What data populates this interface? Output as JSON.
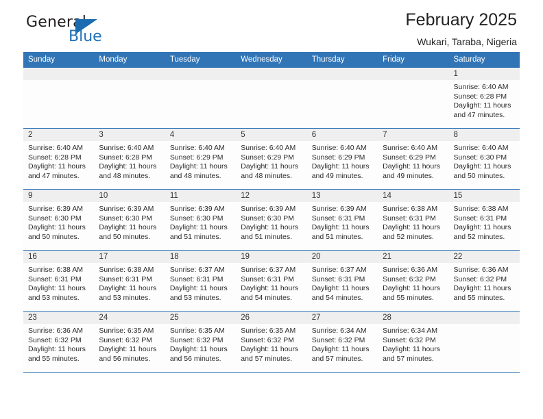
{
  "brand": {
    "name_top": "General",
    "name_bottom": "Blue",
    "accent_color": "#2272b8"
  },
  "header": {
    "title": "February 2025",
    "subtitle": "Wukari, Taraba, Nigeria"
  },
  "calendar": {
    "header_bg": "#3175b6",
    "weekdays": [
      "Sunday",
      "Monday",
      "Tuesday",
      "Wednesday",
      "Thursday",
      "Friday",
      "Saturday"
    ],
    "labels": {
      "sunrise": "Sunrise:",
      "sunset": "Sunset:",
      "daylight": "Daylight:"
    },
    "weeks": [
      [
        {
          "day": ""
        },
        {
          "day": ""
        },
        {
          "day": ""
        },
        {
          "day": ""
        },
        {
          "day": ""
        },
        {
          "day": ""
        },
        {
          "day": "1",
          "sunrise": "Sunrise: 6:40 AM",
          "sunset": "Sunset: 6:28 PM",
          "daylight": "Daylight: 11 hours and 47 minutes."
        }
      ],
      [
        {
          "day": "2",
          "sunrise": "Sunrise: 6:40 AM",
          "sunset": "Sunset: 6:28 PM",
          "daylight": "Daylight: 11 hours and 47 minutes."
        },
        {
          "day": "3",
          "sunrise": "Sunrise: 6:40 AM",
          "sunset": "Sunset: 6:28 PM",
          "daylight": "Daylight: 11 hours and 48 minutes."
        },
        {
          "day": "4",
          "sunrise": "Sunrise: 6:40 AM",
          "sunset": "Sunset: 6:29 PM",
          "daylight": "Daylight: 11 hours and 48 minutes."
        },
        {
          "day": "5",
          "sunrise": "Sunrise: 6:40 AM",
          "sunset": "Sunset: 6:29 PM",
          "daylight": "Daylight: 11 hours and 48 minutes."
        },
        {
          "day": "6",
          "sunrise": "Sunrise: 6:40 AM",
          "sunset": "Sunset: 6:29 PM",
          "daylight": "Daylight: 11 hours and 49 minutes."
        },
        {
          "day": "7",
          "sunrise": "Sunrise: 6:40 AM",
          "sunset": "Sunset: 6:29 PM",
          "daylight": "Daylight: 11 hours and 49 minutes."
        },
        {
          "day": "8",
          "sunrise": "Sunrise: 6:40 AM",
          "sunset": "Sunset: 6:30 PM",
          "daylight": "Daylight: 11 hours and 50 minutes."
        }
      ],
      [
        {
          "day": "9",
          "sunrise": "Sunrise: 6:39 AM",
          "sunset": "Sunset: 6:30 PM",
          "daylight": "Daylight: 11 hours and 50 minutes."
        },
        {
          "day": "10",
          "sunrise": "Sunrise: 6:39 AM",
          "sunset": "Sunset: 6:30 PM",
          "daylight": "Daylight: 11 hours and 50 minutes."
        },
        {
          "day": "11",
          "sunrise": "Sunrise: 6:39 AM",
          "sunset": "Sunset: 6:30 PM",
          "daylight": "Daylight: 11 hours and 51 minutes."
        },
        {
          "day": "12",
          "sunrise": "Sunrise: 6:39 AM",
          "sunset": "Sunset: 6:30 PM",
          "daylight": "Daylight: 11 hours and 51 minutes."
        },
        {
          "day": "13",
          "sunrise": "Sunrise: 6:39 AM",
          "sunset": "Sunset: 6:31 PM",
          "daylight": "Daylight: 11 hours and 51 minutes."
        },
        {
          "day": "14",
          "sunrise": "Sunrise: 6:38 AM",
          "sunset": "Sunset: 6:31 PM",
          "daylight": "Daylight: 11 hours and 52 minutes."
        },
        {
          "day": "15",
          "sunrise": "Sunrise: 6:38 AM",
          "sunset": "Sunset: 6:31 PM",
          "daylight": "Daylight: 11 hours and 52 minutes."
        }
      ],
      [
        {
          "day": "16",
          "sunrise": "Sunrise: 6:38 AM",
          "sunset": "Sunset: 6:31 PM",
          "daylight": "Daylight: 11 hours and 53 minutes."
        },
        {
          "day": "17",
          "sunrise": "Sunrise: 6:38 AM",
          "sunset": "Sunset: 6:31 PM",
          "daylight": "Daylight: 11 hours and 53 minutes."
        },
        {
          "day": "18",
          "sunrise": "Sunrise: 6:37 AM",
          "sunset": "Sunset: 6:31 PM",
          "daylight": "Daylight: 11 hours and 53 minutes."
        },
        {
          "day": "19",
          "sunrise": "Sunrise: 6:37 AM",
          "sunset": "Sunset: 6:31 PM",
          "daylight": "Daylight: 11 hours and 54 minutes."
        },
        {
          "day": "20",
          "sunrise": "Sunrise: 6:37 AM",
          "sunset": "Sunset: 6:31 PM",
          "daylight": "Daylight: 11 hours and 54 minutes."
        },
        {
          "day": "21",
          "sunrise": "Sunrise: 6:36 AM",
          "sunset": "Sunset: 6:32 PM",
          "daylight": "Daylight: 11 hours and 55 minutes."
        },
        {
          "day": "22",
          "sunrise": "Sunrise: 6:36 AM",
          "sunset": "Sunset: 6:32 PM",
          "daylight": "Daylight: 11 hours and 55 minutes."
        }
      ],
      [
        {
          "day": "23",
          "sunrise": "Sunrise: 6:36 AM",
          "sunset": "Sunset: 6:32 PM",
          "daylight": "Daylight: 11 hours and 55 minutes."
        },
        {
          "day": "24",
          "sunrise": "Sunrise: 6:35 AM",
          "sunset": "Sunset: 6:32 PM",
          "daylight": "Daylight: 11 hours and 56 minutes."
        },
        {
          "day": "25",
          "sunrise": "Sunrise: 6:35 AM",
          "sunset": "Sunset: 6:32 PM",
          "daylight": "Daylight: 11 hours and 56 minutes."
        },
        {
          "day": "26",
          "sunrise": "Sunrise: 6:35 AM",
          "sunset": "Sunset: 6:32 PM",
          "daylight": "Daylight: 11 hours and 57 minutes."
        },
        {
          "day": "27",
          "sunrise": "Sunrise: 6:34 AM",
          "sunset": "Sunset: 6:32 PM",
          "daylight": "Daylight: 11 hours and 57 minutes."
        },
        {
          "day": "28",
          "sunrise": "Sunrise: 6:34 AM",
          "sunset": "Sunset: 6:32 PM",
          "daylight": "Daylight: 11 hours and 57 minutes."
        },
        {
          "day": ""
        }
      ]
    ]
  }
}
